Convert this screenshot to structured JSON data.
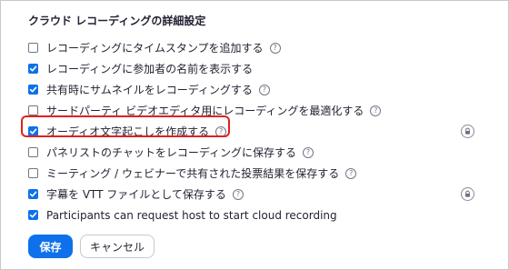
{
  "section_title": "クラウド レコーディングの詳細設定",
  "help_glyph": "?",
  "options": [
    {
      "label": "レコーディングにタイムスタンプを追加する",
      "checked": false,
      "help": true,
      "locked": false
    },
    {
      "label": "レコーディングに参加者の名前を表示する",
      "checked": true,
      "help": false,
      "locked": false
    },
    {
      "label": "共有時にサムネイルをレコーディングする",
      "checked": true,
      "help": true,
      "locked": false
    },
    {
      "label": "サードパーティ ビデオエディタ用にレコーディングを最適化する",
      "checked": false,
      "help": true,
      "locked": false
    },
    {
      "label": "オーディオ文字起こしを作成する",
      "checked": true,
      "help": true,
      "locked": true,
      "highlighted": true
    },
    {
      "label": "パネリストのチャットをレコーディングに保存する",
      "checked": false,
      "help": true,
      "locked": false
    },
    {
      "label": "ミーティング / ウェビナーで共有された投票結果を保存する",
      "checked": false,
      "help": true,
      "locked": false
    },
    {
      "label": "字幕を VTT ファイルとして保存する",
      "checked": true,
      "help": true,
      "locked": true
    },
    {
      "label": "Participants can request host to start cloud recording",
      "checked": true,
      "help": false,
      "locked": false
    }
  ],
  "buttons": {
    "save": "保存",
    "cancel": "キャンセル"
  },
  "colors": {
    "accent": "#0e71eb",
    "highlight": "#e02020"
  }
}
